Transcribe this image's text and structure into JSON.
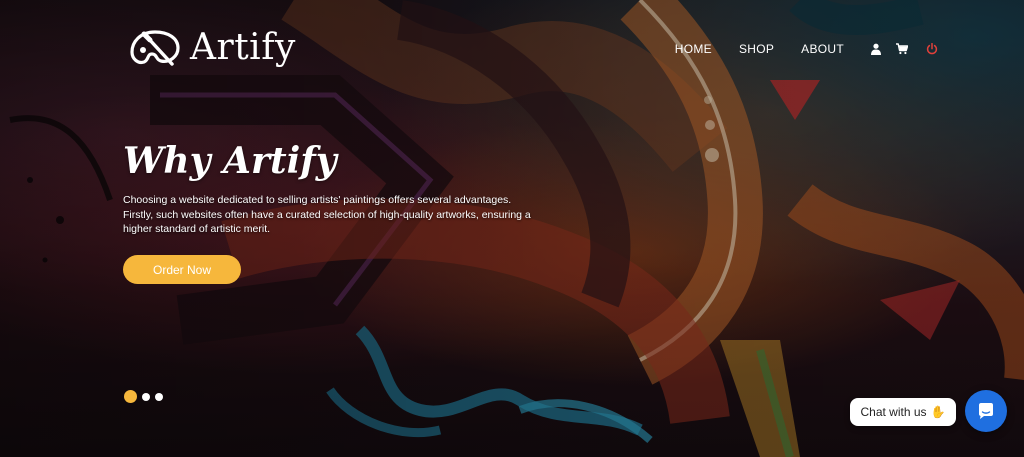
{
  "brand": {
    "name": "Artify",
    "logo_icon": "paint-palette-icon"
  },
  "nav": {
    "items": [
      {
        "label": "HOME"
      },
      {
        "label": "SHOP"
      },
      {
        "label": "ABOUT"
      }
    ],
    "icons": [
      "user-icon",
      "cart-icon",
      "power-icon"
    ],
    "power_color": "#e0403a"
  },
  "hero": {
    "title": "Why Artify",
    "description": "Choosing a website dedicated to selling artists' paintings offers several advantages. Firstly, such websites often have a curated selection of high-quality artworks, ensuring a higher standard of artistic merit.",
    "cta_label": "Order Now",
    "slide_count": 3,
    "active_slide": 1
  },
  "chat": {
    "pill_text": "Chat with us",
    "pill_icon": "waving-hand-icon",
    "button_icon": "chat-bubble-icon",
    "button_color": "#1f6fe0"
  },
  "colors": {
    "accent": "#f6b73c",
    "text": "#ffffff"
  }
}
